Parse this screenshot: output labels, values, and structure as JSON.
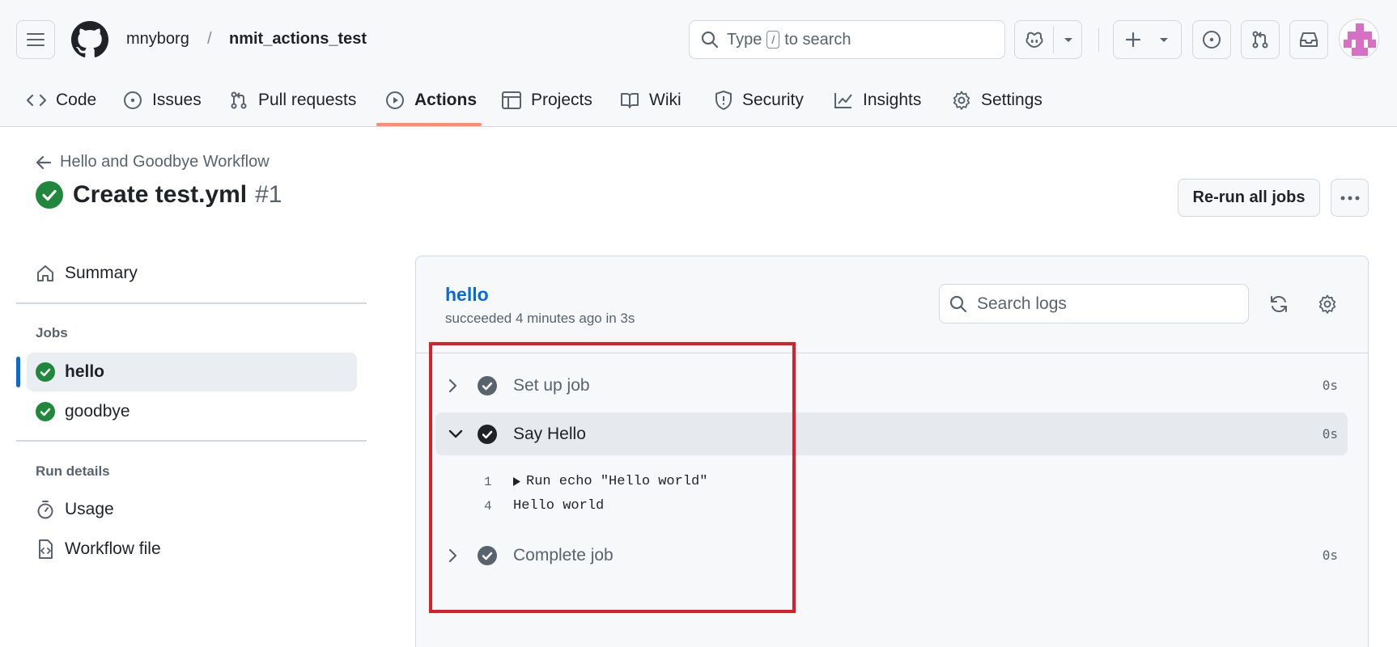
{
  "header": {
    "owner": "mnyborg",
    "separator": "/",
    "repo": "nmit_actions_test",
    "search": {
      "prefix": "Type",
      "key": "/",
      "suffix": "to search"
    }
  },
  "tabs": [
    {
      "label": "Code",
      "icon": "code-icon"
    },
    {
      "label": "Issues",
      "icon": "issue-icon"
    },
    {
      "label": "Pull requests",
      "icon": "pull-request-icon"
    },
    {
      "label": "Actions",
      "icon": "play-icon",
      "active": true
    },
    {
      "label": "Projects",
      "icon": "table-icon"
    },
    {
      "label": "Wiki",
      "icon": "book-icon"
    },
    {
      "label": "Security",
      "icon": "shield-icon"
    },
    {
      "label": "Insights",
      "icon": "graph-icon"
    },
    {
      "label": "Settings",
      "icon": "gear-icon"
    }
  ],
  "run": {
    "workflow": "Hello and Goodbye Workflow",
    "title": "Create test.yml",
    "number": "#1",
    "rerun_label": "Re-run all jobs"
  },
  "sidebar": {
    "summary": "Summary",
    "jobs_heading": "Jobs",
    "jobs": [
      {
        "label": "hello",
        "status": "success",
        "active": true
      },
      {
        "label": "goodbye",
        "status": "success"
      }
    ],
    "details_heading": "Run details",
    "details": [
      {
        "label": "Usage",
        "icon": "stopwatch-icon"
      },
      {
        "label": "Workflow file",
        "icon": "file-code-icon"
      }
    ]
  },
  "job": {
    "name": "hello",
    "status_text": "succeeded 4 minutes ago in 3s",
    "search_placeholder": "Search logs",
    "steps": [
      {
        "label": "Set up job",
        "duration": "0s",
        "expanded": false
      },
      {
        "label": "Say Hello",
        "duration": "0s",
        "expanded": true
      },
      {
        "label": "Complete job",
        "duration": "0s",
        "expanded": false
      }
    ],
    "log_lines": [
      {
        "number": "1",
        "text": "Run echo \"Hello world\"",
        "collapsible": true
      },
      {
        "number": "4",
        "text": "Hello world",
        "collapsible": false
      }
    ]
  },
  "colors": {
    "accent": "#0969da",
    "success": "#1f883d",
    "tab_underline": "#fd8c73",
    "annotation": "#d9202a"
  }
}
